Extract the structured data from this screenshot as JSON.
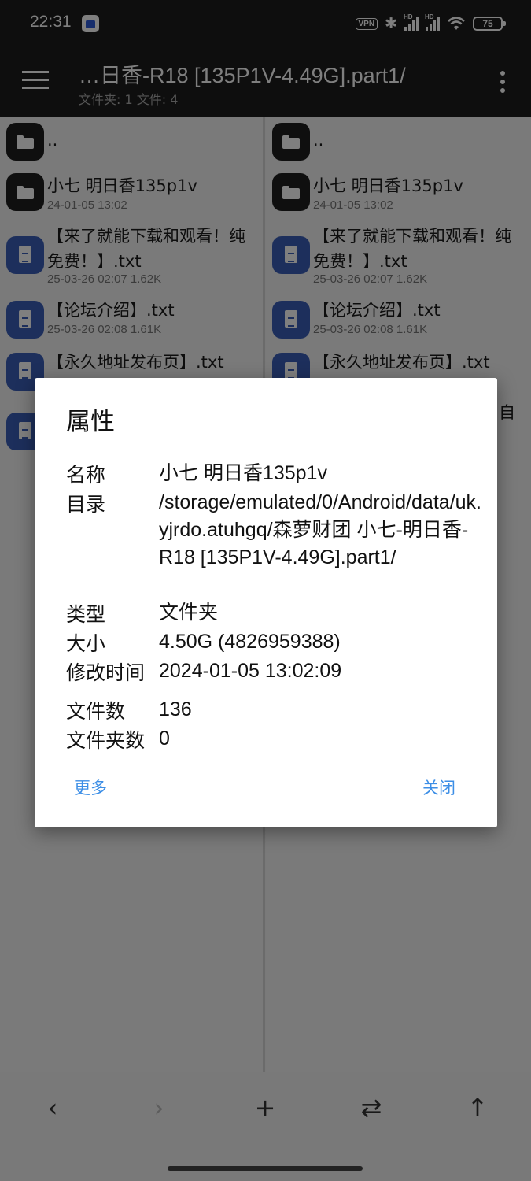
{
  "status": {
    "time": "22:31",
    "vpn": "VPN",
    "sig1": "HD",
    "sig2": "HD",
    "battery": "75"
  },
  "appbar": {
    "title": "…日香-R18 [135P1V-4.49G].part1/",
    "subtitle": "文件夹: 1  文件: 4"
  },
  "panes": {
    "left": [
      {
        "name": "..",
        "meta": "",
        "icon": "folder-icon"
      },
      {
        "name": "小七 明日香135p1v",
        "meta": "24-01-05 13:02",
        "icon": "folder-icon"
      },
      {
        "name": "【来了就能下载和观看！纯免费！】.txt",
        "meta": "25-03-26 02:07  1.62K",
        "icon": "text-file-icon"
      },
      {
        "name": "【论坛介绍】.txt",
        "meta": "25-03-26 02:08  1.61K",
        "icon": "text-file-icon"
      },
      {
        "name": "【永久地址发布页】.txt",
        "meta": "",
        "icon": "text-file-icon"
      }
    ],
    "right": [
      {
        "name": "..",
        "meta": "",
        "icon": "folder-icon"
      },
      {
        "name": "小七 明日香135p1v",
        "meta": "24-01-05 13:02",
        "icon": "folder-icon"
      },
      {
        "name": "【来了就能下载和观看！纯免费！】.txt",
        "meta": "25-03-26 02:07  1.62K",
        "icon": "text-file-icon"
      },
      {
        "name": "【论坛介绍】.txt",
        "meta": "25-03-26 02:08  1.61K",
        "icon": "text-file-icon"
      },
      {
        "name": "【永久地址发布页】.txt",
        "meta": "",
        "icon": "text-file-icon"
      },
      {
        "name": "自",
        "meta": "",
        "icon": "text-file-icon"
      }
    ]
  },
  "bottom_nav": {
    "back": "‹",
    "forward": "›",
    "add": "+",
    "swap": "⇄",
    "up": "↑"
  },
  "dialog": {
    "title": "属性",
    "props": [
      {
        "label": "名称",
        "value": "小七 明日香135p1v"
      },
      {
        "label": "目录",
        "value": "/storage/emulated/0/Android/data/uk.yjrdo.atuhgq/森萝财团 小七-明日香-R18 [135P1V-4.49G].part1/"
      },
      {
        "label": "类型",
        "value": "文件夹"
      },
      {
        "label": "大小",
        "value": "4.50G (4826959388)"
      },
      {
        "label": "修改时间",
        "value": "2024-01-05 13:02:09"
      },
      {
        "label": "文件数",
        "value": "136"
      },
      {
        "label": "文件夹数",
        "value": "0"
      }
    ],
    "more_button": "更多",
    "close_button": "关闭"
  }
}
